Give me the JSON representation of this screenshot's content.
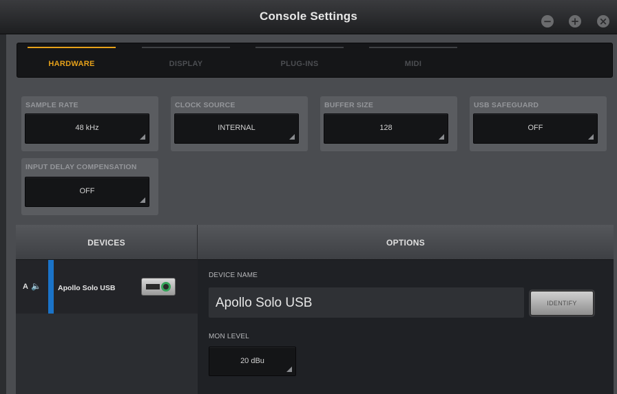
{
  "window": {
    "title": "Console Settings",
    "controls": {
      "minimize": "−",
      "maximize": "+",
      "close": "×"
    }
  },
  "tabs": [
    {
      "label": "HARDWARE",
      "active": true
    },
    {
      "label": "DISPLAY",
      "active": false
    },
    {
      "label": "PLUG-INS",
      "active": false
    },
    {
      "label": "MIDI",
      "active": false
    }
  ],
  "settings": {
    "sample_rate": {
      "label": "SAMPLE RATE",
      "value": "48 kHz"
    },
    "clock_source": {
      "label": "CLOCK SOURCE",
      "value": "INTERNAL"
    },
    "buffer_size": {
      "label": "BUFFER SIZE",
      "value": "128"
    },
    "usb_safeguard": {
      "label": "USB SAFEGUARD",
      "value": "OFF"
    },
    "input_delay": {
      "label": "INPUT DELAY COMPENSATION",
      "value": "OFF"
    }
  },
  "devices": {
    "header": "DEVICES",
    "items": [
      {
        "letter": "A",
        "name": "Apollo Solo USB",
        "icon": "speaker-icon"
      }
    ]
  },
  "options": {
    "header": "OPTIONS",
    "device_name_label": "DEVICE NAME",
    "device_name": "Apollo Solo USB",
    "identify_label": "IDENTIFY",
    "mon_level_label": "MON LEVEL",
    "mon_level_value": "20 dBu"
  },
  "colors": {
    "accent": "#e7a21a",
    "selection_bar": "#1a73c8",
    "background": "#4a4c50"
  }
}
